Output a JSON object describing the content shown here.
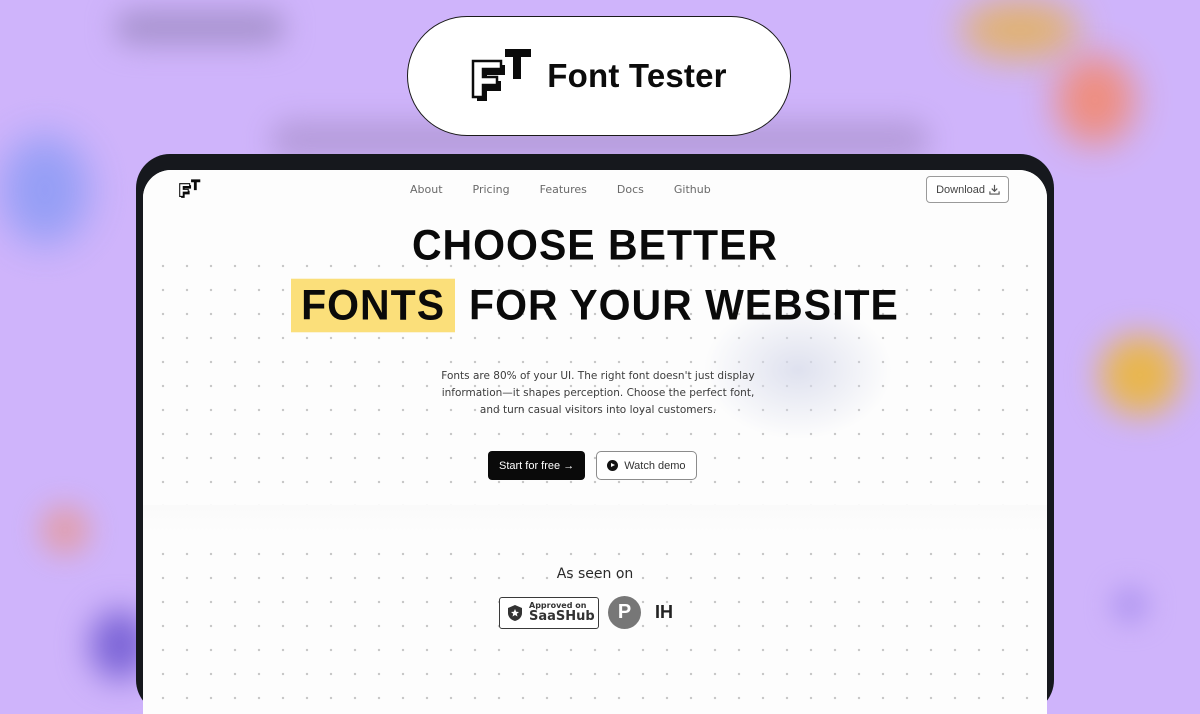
{
  "banner": {
    "brand_name": "Font Tester",
    "logo_icon": "ft-logo-icon"
  },
  "nav": {
    "logo_icon": "ft-logo-icon",
    "links": [
      "About",
      "Pricing",
      "Features",
      "Docs",
      "Github"
    ],
    "download_label": "Download",
    "download_icon": "download-icon"
  },
  "hero": {
    "line1": "CHOOSE BETTER",
    "highlight": "FONTS",
    "line2_rest": "FOR YOUR WEBSITE",
    "highlight_color": "#fbdf7a",
    "description": "Fonts are 80% of your UI. The right font doesn't just display information—it shapes perception. Choose the perfect font, and turn casual visitors into loyal customers.",
    "primary_cta": "Start for free →",
    "secondary_cta": "Watch demo",
    "secondary_icon": "play-icon"
  },
  "social_proof": {
    "heading": "As seen on",
    "saashub_top": "Approved on",
    "saashub_bottom": "SaaSHub",
    "producthunt_letter": "P",
    "indiehackers_label": "IH"
  },
  "colors": {
    "background": "#cfb4fb",
    "device_frame": "#16181d",
    "primary_button": "#0a0a0a"
  }
}
